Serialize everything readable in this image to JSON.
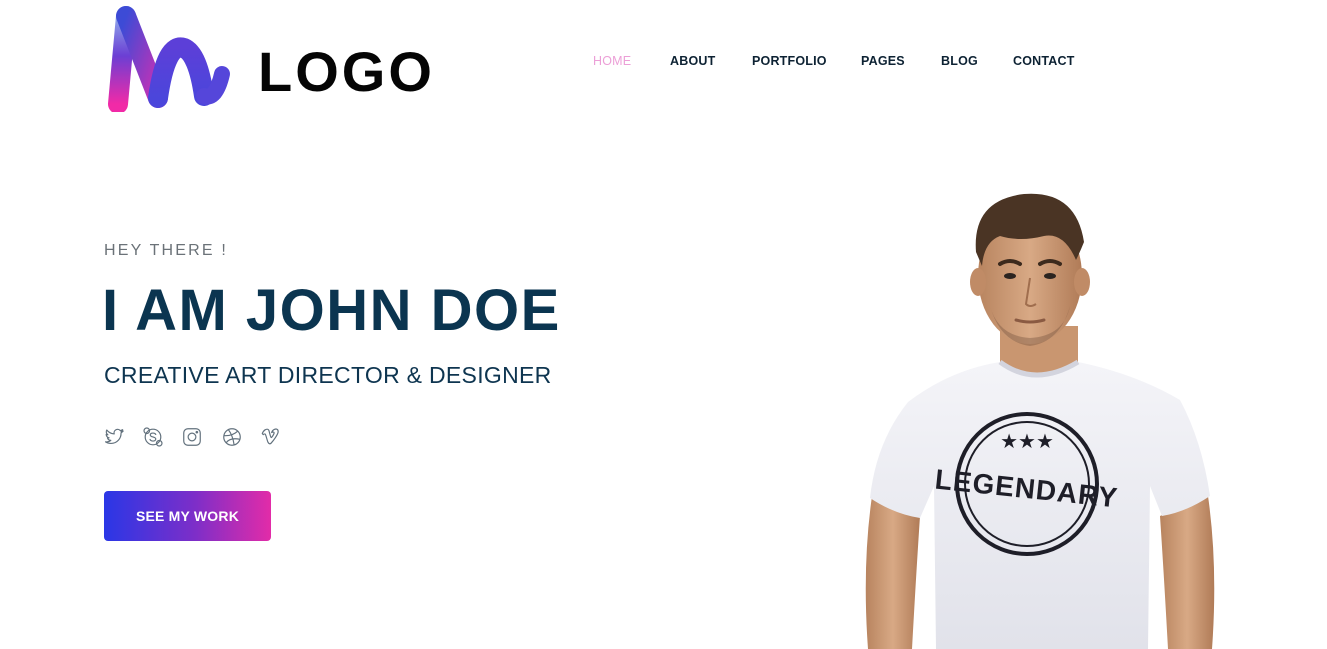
{
  "header": {
    "logo_text": "LOGO",
    "logo_icon": "gradient-m-logo-icon",
    "nav": [
      {
        "label": "HOME",
        "active": true
      },
      {
        "label": "ABOUT",
        "active": false
      },
      {
        "label": "PORTFOLIO",
        "active": false
      },
      {
        "label": "PAGES",
        "active": false
      },
      {
        "label": "BLOG",
        "active": false
      },
      {
        "label": "CONTACT",
        "active": false
      }
    ]
  },
  "hero": {
    "eyebrow": "HEY THERE !",
    "headline": "I AM JOHN DOE",
    "subtitle": "CREATIVE ART DIRECTOR & DESIGNER",
    "socials": [
      {
        "icon": "twitter-icon"
      },
      {
        "icon": "skype-icon"
      },
      {
        "icon": "instagram-icon"
      },
      {
        "icon": "dribbble-icon"
      },
      {
        "icon": "vimeo-icon"
      }
    ],
    "cta_label": "SEE MY WORK",
    "portrait": {
      "shirt_text": "LEGENDARY"
    }
  },
  "colors": {
    "heading": "#0b3550",
    "nav_active": "#ec9fd7",
    "gradient_start": "#2a37e6",
    "gradient_end": "#e22ca8",
    "text_muted": "#6b7278"
  }
}
